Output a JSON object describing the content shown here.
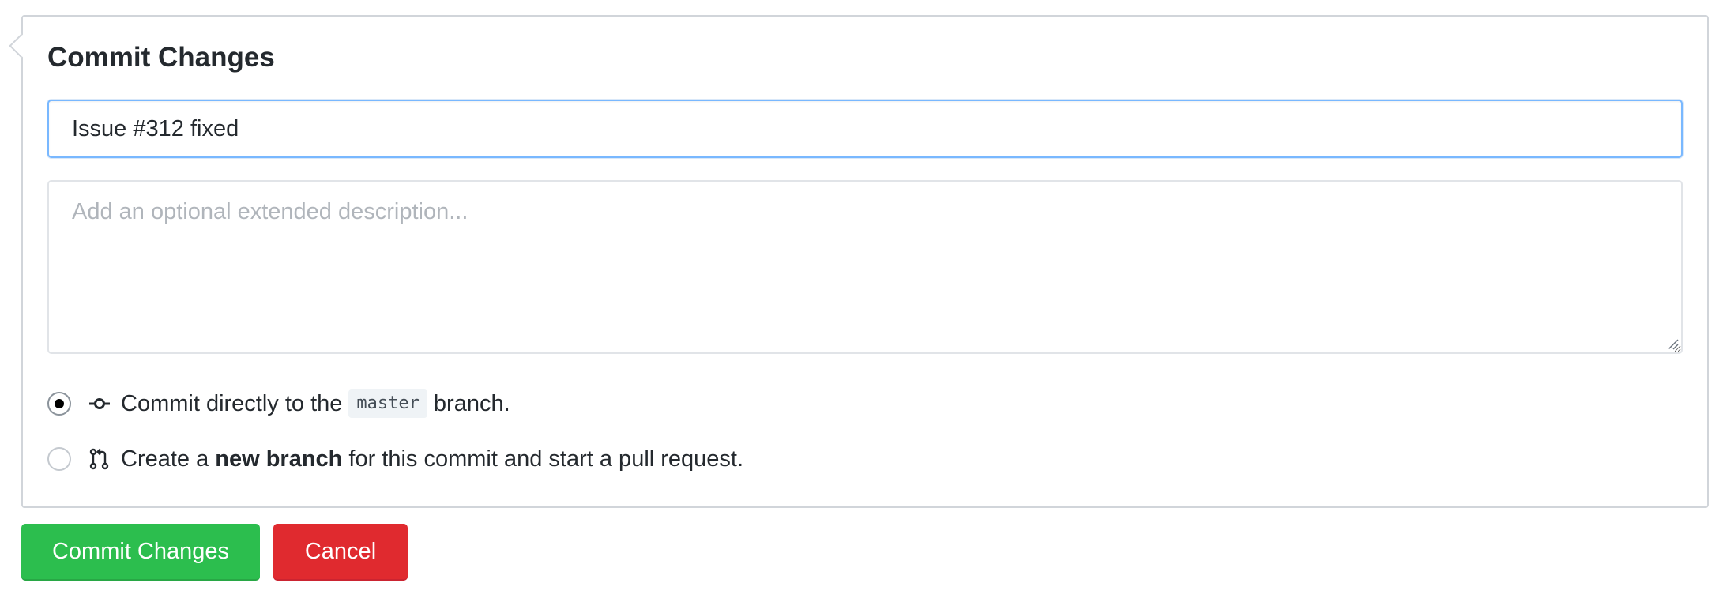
{
  "form": {
    "title": "Commit Changes",
    "summary_value": "Issue #312 fixed",
    "description_placeholder": "Add an optional extended description...",
    "description_value": ""
  },
  "options": {
    "direct": {
      "selected": true,
      "icon": "git-commit-icon",
      "text_before": "Commit directly to the",
      "branch_name": "master",
      "text_after": "branch."
    },
    "new_branch": {
      "selected": false,
      "icon": "git-pull-request-icon",
      "text_before": "Create a",
      "bold_text": "new branch",
      "text_after": "for this commit and start a pull request."
    }
  },
  "buttons": {
    "commit_label": "Commit Changes",
    "cancel_label": "Cancel"
  },
  "colors": {
    "commit_button": "#2cbe4e",
    "cancel_button": "#e02a2f",
    "input_focus_border": "#79b8ff",
    "panel_border": "#d1d5da"
  }
}
